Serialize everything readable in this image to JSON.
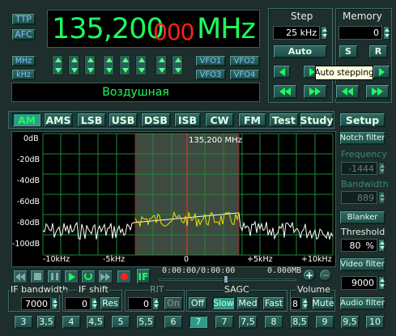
{
  "mode_left": {
    "ttp": "TTP",
    "afc": "AFC",
    "mhz": "MHz",
    "khz": "kHz"
  },
  "frequency": {
    "main": "135,200",
    "sub": "000",
    "unit": "MHz"
  },
  "band_name": "Воздушная",
  "vfo": [
    "VFO1",
    "VFO2",
    "VFO3",
    "VFO4"
  ],
  "step": {
    "title": "Step",
    "value": "25 kHz",
    "auto": "Auto"
  },
  "memory": {
    "title": "Memory",
    "value": "0",
    "save": "S",
    "recall": "R"
  },
  "tooltip": "Auto stepping",
  "modes": [
    "AM",
    "AMS",
    "LSB",
    "USB",
    "DSB",
    "ISB",
    "CW",
    "FM",
    "Test",
    "Study"
  ],
  "setup": "Setup",
  "spectrum": {
    "marker_label": "135,200 MHz",
    "y_ticks": [
      "0dB",
      "-20dB",
      "-40dB",
      "-60dB",
      "-80dB",
      "-100dB"
    ],
    "x_ticks": [
      "-10kHz",
      "-5kHz",
      "0",
      "+5kHz",
      "+10kHz"
    ]
  },
  "right_panel": {
    "notch": "Notch filter",
    "freq_label": "Frequency",
    "freq_value": "-1444",
    "bw_label": "Bandwidth",
    "bw_value": "889",
    "blanker": "Blanker",
    "threshold_label": "Threshold",
    "threshold_value": "80",
    "threshold_unit": "%",
    "video_filter": "Video filter",
    "video_value": "9000",
    "audio_filter": "Audio filter"
  },
  "player": {
    "time": "0:00:00/0:00:00",
    "size": "0.000MB",
    "if_label": "IF"
  },
  "bottom": {
    "if_bw_label": "IF bandwidth",
    "if_bw_value": "7000",
    "if_shift_label": "IF shift",
    "if_shift_value": "0",
    "res": "Res",
    "rit_label": "RIT",
    "rit_value": "0",
    "rit_on": "On",
    "sagc_label": "SAGC",
    "sagc_off": "Off",
    "sagc_slow": "Slow",
    "sagc_med": "Med",
    "sagc_fast": "Fast",
    "volume_label": "Volume",
    "volume_value": "8",
    "mute": "Mute"
  },
  "bw_presets": [
    "3",
    "3,5",
    "4",
    "4,5",
    "5",
    "5,5",
    "6",
    "7",
    "7,5",
    "8",
    "8,5",
    "9",
    "9,5",
    "10"
  ],
  "colors": {
    "accent_green": "#1aff5a",
    "freq_red": "#ff2020",
    "signal_yellow": "#e8e000",
    "marker_red": "#ff3030"
  }
}
